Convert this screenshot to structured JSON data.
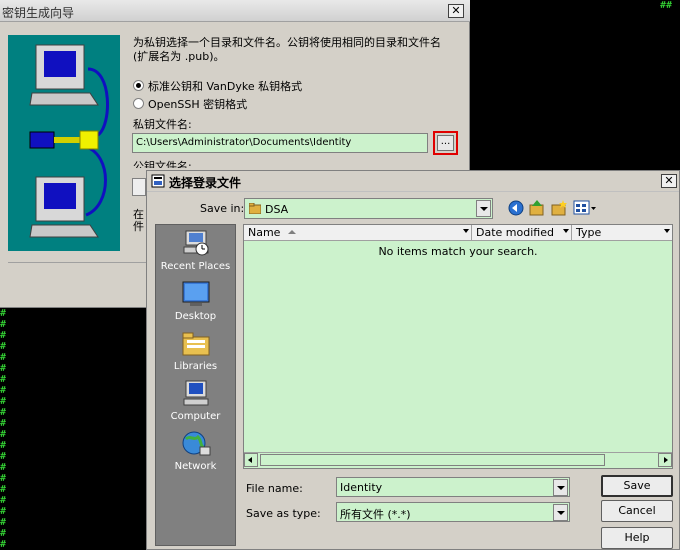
{
  "wizard": {
    "title": "密钥生成向导",
    "instruction": "为私钥选择一个目录和文件名。公钥将使用相同的目录和文件名(扩展名为 .pub)。",
    "format_vandyke": "标准公钥和 VanDyke 私钥格式",
    "format_openssh": "OpenSSH 密钥格式",
    "private_key_label": "私钥文件名:",
    "private_key_value": "C:\\Users\\Administrator\\Documents\\Identity",
    "browse_label": "...",
    "public_key_label": "公钥文件名:",
    "clipped_text": "在",
    "clipped_text2": "件"
  },
  "dialog": {
    "title": "选择登录文件",
    "save_in_label": "Save in:",
    "save_in_value": "DSA",
    "places": [
      {
        "label": "Recent Places"
      },
      {
        "label": "Desktop"
      },
      {
        "label": "Libraries"
      },
      {
        "label": "Computer"
      },
      {
        "label": "Network"
      }
    ],
    "columns": {
      "name": "Name",
      "date": "Date modified",
      "type": "Type"
    },
    "empty_message": "No items match your search.",
    "file_name_label": "File name:",
    "file_name_value": "Identity",
    "save_type_label": "Save as type:",
    "save_type_value": "所有文件 (*.*)",
    "save_button": "Save",
    "cancel_button": "Cancel",
    "help_button": "Help"
  },
  "terminal": {
    "right_char": "#"
  },
  "icons": {
    "close": "close-icon",
    "back": "back-icon",
    "up": "up-folder-icon",
    "new_folder": "new-folder-icon",
    "views": "views-menu-icon"
  },
  "colors": {
    "accent_input": "#ccf2cc",
    "teal_panel": "#008080",
    "highlight": "#e00000"
  }
}
